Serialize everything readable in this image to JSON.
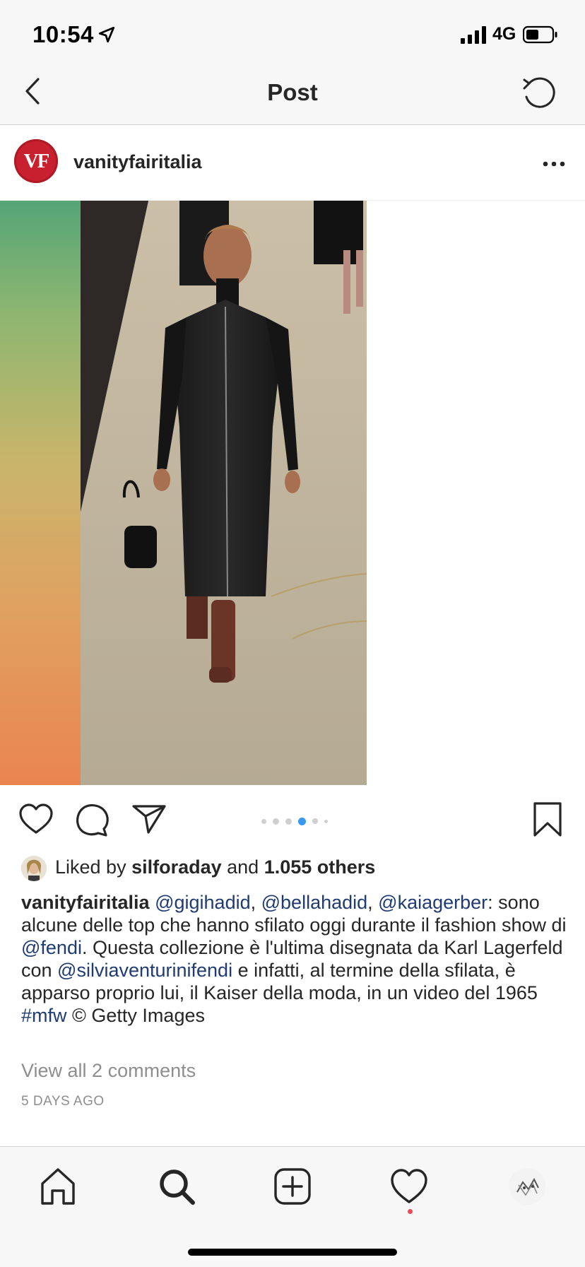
{
  "status_bar": {
    "time": "10:54",
    "network": "4G"
  },
  "nav": {
    "title": "Post"
  },
  "post": {
    "username": "vanityfairitalia",
    "avatar_text": "VF",
    "carousel": {
      "total": 6,
      "active_index": 3
    },
    "liker_prefix": "Liked by ",
    "liker_name": "silforaday",
    "likes_and": " and ",
    "likes_others": "1.055 others",
    "caption": {
      "author": "vanityfairitalia",
      "mention1": "@gigihadid",
      "sep1": ", ",
      "mention2": "@bellahadid",
      "sep2": ", ",
      "mention3": "@kaiagerber",
      "text1": ": sono alcune delle top che hanno sfilato oggi durante il fashion show di ",
      "mention4": "@fendi",
      "text2": ". Questa collezione è l'ultima disegnata da Karl Lagerfeld con ",
      "mention5": "@silviaventurinifendi",
      "text3": " e infatti, al termine della sfilata, è apparso proprio lui, il Kaiser della moda, in un video del 1965 ",
      "hashtag": "#mfw",
      "text4": " © Getty Images"
    },
    "view_comments": "View all 2 comments",
    "time_ago": "5 DAYS AGO"
  },
  "icons": {
    "status": [
      "location-arrow-icon",
      "signal-icon",
      "battery-icon"
    ],
    "nav": [
      "back-icon",
      "refresh-icon"
    ],
    "actions": [
      "heart-icon",
      "comment-icon",
      "share-icon",
      "bookmark-icon",
      "more-icon"
    ],
    "tabs": [
      "home-icon",
      "search-icon",
      "new-post-icon",
      "activity-icon",
      "profile-icon"
    ]
  },
  "colors": {
    "link": "#1f3b74",
    "carousel_active": "#3897f0",
    "notification": "#ed4956",
    "avatar_brand": "#c8202f"
  }
}
